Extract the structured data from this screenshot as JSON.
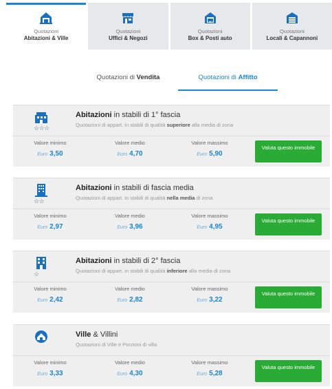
{
  "tabs": [
    {
      "top": "Quotazioni",
      "bottom": "Abitazioni & Ville",
      "icon": "house-icon"
    },
    {
      "top": "Quotazioni",
      "bottom": "Uffici & Negozi",
      "icon": "shop-icon"
    },
    {
      "top": "Quotazioni",
      "bottom": "Box & Posti auto",
      "icon": "garage-icon"
    },
    {
      "top": "Quotazioni",
      "bottom": "Locali & Capannoni",
      "icon": "warehouse-icon"
    }
  ],
  "subtabs": {
    "sale": {
      "prefix": "Quotazioni di ",
      "bold": "Vendita"
    },
    "rent": {
      "prefix": "Quotazioni di ",
      "bold": "Affitto"
    }
  },
  "labels": {
    "min": "Valore minimo",
    "mid": "Valore medio",
    "max": "Valore massimo",
    "currency": "Euro",
    "button": "Valuta questo immobile"
  },
  "cards": [
    {
      "icon": "building-icon",
      "stars": "☆☆☆",
      "title_bold": "Abitazioni",
      "title_rest": " in stabili di 1° fascia",
      "sub_pre": "Quotazioni di appart. in stabili di qualità ",
      "sub_bold": "superiore",
      "sub_post": " alla media di zona",
      "min": "3,50",
      "mid": "4,70",
      "max": "5,90"
    },
    {
      "icon": "apartment-icon",
      "stars": "☆☆",
      "title_bold": "Abitazioni",
      "title_rest": " in stabili di fascia media",
      "sub_pre": "Quotazioni di appart. in stabili di qualità ",
      "sub_bold": "nella media",
      "sub_post": " di zona",
      "min": "2,97",
      "mid": "3,96",
      "max": "4,95"
    },
    {
      "icon": "block-icon",
      "stars": "☆",
      "title_bold": "Abitazioni",
      "title_rest": " in stabili di 2° fascia",
      "sub_pre": "Quotazioni di appart. in stabili di qualità ",
      "sub_bold": "inferiore",
      "sub_post": " alla media di zona",
      "min": "2,42",
      "mid": "2,82",
      "max": "3,22"
    },
    {
      "icon": "villa-icon",
      "stars": "",
      "title_bold": "Ville",
      "title_rest": " & Villini",
      "sub_pre": "Quotazioni di Ville e Porzioni di villa",
      "sub_bold": "",
      "sub_post": "",
      "min": "3,33",
      "mid": "4,30",
      "max": "5,28"
    }
  ],
  "colors": {
    "accent": "#1a86d0",
    "button": "#2aab35",
    "icon": "#1a6fc0"
  }
}
